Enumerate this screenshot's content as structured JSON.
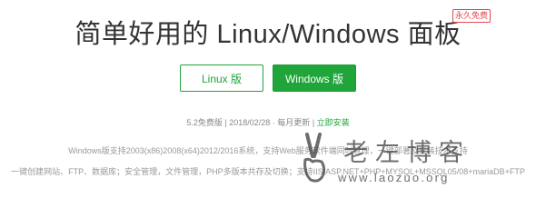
{
  "header": {
    "title": "简单好用的 Linux/Windows 面板",
    "badge": "永久免费"
  },
  "buttons": {
    "linux": "Linux 版",
    "windows": "Windows 版"
  },
  "meta": {
    "version": "5.2免费版",
    "date": "2018/02/28",
    "update": "每月更新",
    "install": "立即安装"
  },
  "description": {
    "line1": "Windows版支持2003(x86)2008(x64)2012/2016系统，支持Web服务软件端同时管理，一键部署及安装技术支持",
    "line2": "一键创建网站、FTP、数据库；安全管理，文件管理，PHP多版本共存及切换；支持IIS/ASP.NET+PHP+MYSQL+MSSQL05/08+mariaDB+FTP"
  },
  "watermark": {
    "name": "老左博客",
    "url": "www.laozuo.org"
  },
  "colors": {
    "accent": "#20a53a",
    "badge": "#e5484d"
  }
}
